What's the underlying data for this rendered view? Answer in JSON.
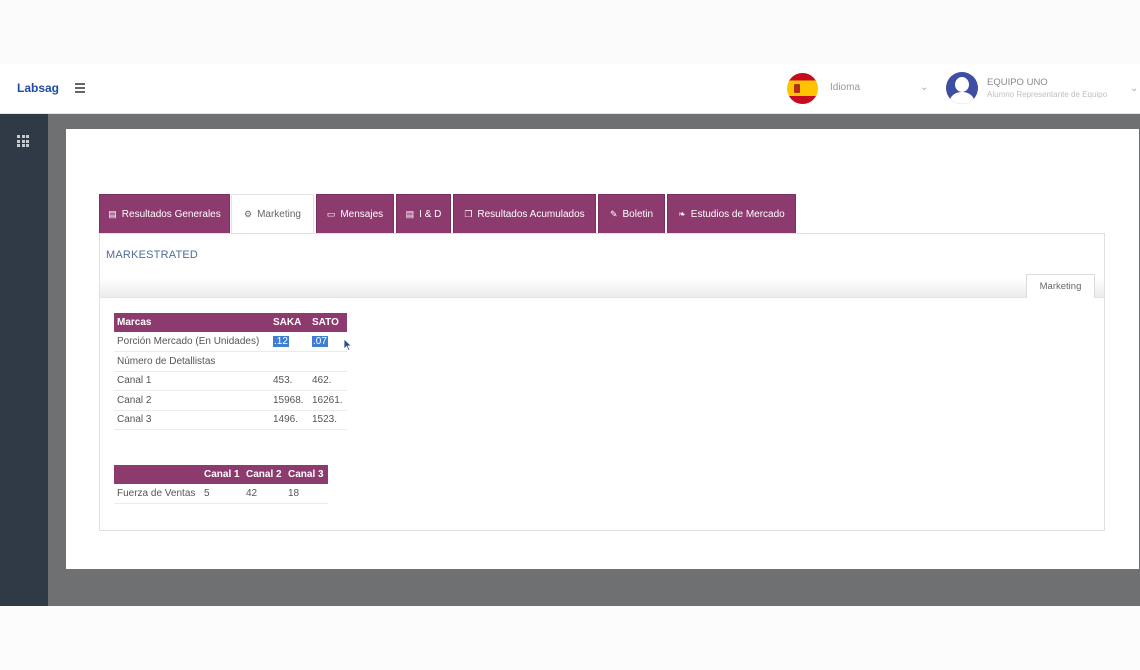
{
  "app": {
    "brand": "Labsag",
    "language_label": "Idioma",
    "user_name": "EQUIPO UNO",
    "user_role": "Alumno Representante de Equipo"
  },
  "tabs": [
    {
      "label": "Resultados Generales",
      "icon": "document-icon",
      "active": false
    },
    {
      "label": "Marketing",
      "icon": "gears-icon",
      "active": true
    },
    {
      "label": "Mensajes",
      "icon": "message-icon",
      "active": false
    },
    {
      "label": "I & D",
      "icon": "document-icon",
      "active": false
    },
    {
      "label": "Resultados Acumulados",
      "icon": "copy-icon",
      "active": false
    },
    {
      "label": "Boletin",
      "icon": "pen-icon",
      "active": false
    },
    {
      "label": "Estudios de Mercado",
      "icon": "leaf-icon",
      "active": false
    }
  ],
  "section": {
    "title": "MARKESTRATED",
    "inner_tab": "Marketing"
  },
  "table1": {
    "headers": [
      "Marcas",
      "SAKA",
      "SATO"
    ],
    "rows": [
      [
        "Porción Mercado (En Unidades)",
        ".12",
        ".07"
      ],
      [
        "Número de Detallistas",
        "",
        ""
      ],
      [
        "Canal 1",
        "453.",
        "462."
      ],
      [
        "Canal 2",
        "15968.",
        "16261."
      ],
      [
        "Canal 3",
        "1496.",
        "1523."
      ]
    ]
  },
  "table2": {
    "headers": [
      "",
      "Canal 1",
      "Canal 2",
      "Canal 3"
    ],
    "rows": [
      [
        "Fuerza de Ventas",
        "5",
        "42",
        "18"
      ]
    ]
  },
  "colors": {
    "accent": "#8d3a6e",
    "brand": "#1f4aa6",
    "sidebar": "#2f3a46",
    "selection": "#3f7ed3"
  }
}
